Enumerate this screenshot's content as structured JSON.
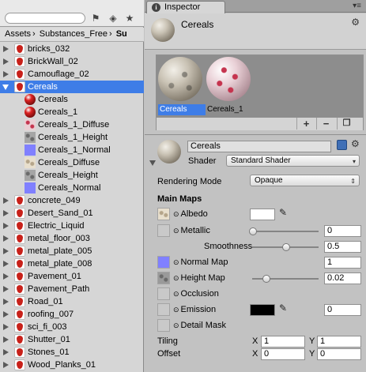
{
  "project": {
    "breadcrumb": [
      "Assets",
      "Substances_Free",
      "Su"
    ],
    "items": [
      {
        "label": "bricks_032",
        "type": "substance",
        "indent": 0,
        "expandable": true
      },
      {
        "label": "BrickWall_02",
        "type": "substance",
        "indent": 0,
        "expandable": true
      },
      {
        "label": "Camouflage_02",
        "type": "substance",
        "indent": 0,
        "expandable": true
      },
      {
        "label": "Cereals",
        "type": "substance",
        "indent": 0,
        "expandable": true,
        "expanded": true,
        "selected": true
      },
      {
        "label": "Cereals",
        "type": "material",
        "indent": 1
      },
      {
        "label": "Cereals_1",
        "type": "material",
        "indent": 1
      },
      {
        "label": "Cereals_1_Diffuse",
        "type": "texture-pink",
        "indent": 1
      },
      {
        "label": "Cereals_1_Height",
        "type": "texture-gray",
        "indent": 1
      },
      {
        "label": "Cereals_1_Normal",
        "type": "texture-blue",
        "indent": 1
      },
      {
        "label": "Cereals_Diffuse",
        "type": "texture-beige",
        "indent": 1
      },
      {
        "label": "Cereals_Height",
        "type": "texture-gray",
        "indent": 1
      },
      {
        "label": "Cereals_Normal",
        "type": "texture-blue",
        "indent": 1
      },
      {
        "label": "concrete_049",
        "type": "substance",
        "indent": 0,
        "expandable": true
      },
      {
        "label": "Desert_Sand_01",
        "type": "substance",
        "indent": 0,
        "expandable": true
      },
      {
        "label": "Electric_Liquid",
        "type": "substance",
        "indent": 0,
        "expandable": true
      },
      {
        "label": "metal_floor_003",
        "type": "substance",
        "indent": 0,
        "expandable": true
      },
      {
        "label": "metal_plate_005",
        "type": "substance",
        "indent": 0,
        "expandable": true
      },
      {
        "label": "metal_plate_008",
        "type": "substance",
        "indent": 0,
        "expandable": true
      },
      {
        "label": "Pavement_01",
        "type": "substance",
        "indent": 0,
        "expandable": true
      },
      {
        "label": "Pavement_Path",
        "type": "substance",
        "indent": 0,
        "expandable": true
      },
      {
        "label": "Road_01",
        "type": "substance",
        "indent": 0,
        "expandable": true
      },
      {
        "label": "roofing_007",
        "type": "substance",
        "indent": 0,
        "expandable": true
      },
      {
        "label": "sci_fi_003",
        "type": "substance",
        "indent": 0,
        "expandable": true
      },
      {
        "label": "Shutter_01",
        "type": "substance",
        "indent": 0,
        "expandable": true
      },
      {
        "label": "Stones_01",
        "type": "substance",
        "indent": 0,
        "expandable": true
      },
      {
        "label": "Wood_Planks_01",
        "type": "substance",
        "indent": 0,
        "expandable": true
      }
    ]
  },
  "inspector": {
    "tab_label": "Inspector",
    "header_title": "Cereals",
    "previews": [
      {
        "label": "Cereals",
        "selected": true
      },
      {
        "label": "Cereals_1",
        "selected": false
      }
    ],
    "preview_buttons": [
      "+",
      "−"
    ],
    "material": {
      "name": "Cereals",
      "shader_label": "Shader",
      "shader_value": "Standard Shader"
    },
    "rendering_mode_label": "Rendering Mode",
    "rendering_mode_value": "Opaque",
    "main_maps_label": "Main Maps",
    "albedo_label": "Albedo",
    "metallic_label": "Metallic",
    "metallic_value": "0",
    "smoothness_label": "Smoothness",
    "smoothness_value": "0.5",
    "normal_map_label": "Normal Map",
    "normal_map_value": "1",
    "height_map_label": "Height Map",
    "height_map_value": "0.02",
    "occlusion_label": "Occlusion",
    "emission_label": "Emission",
    "emission_value": "0",
    "detail_mask_label": "Detail Mask",
    "tiling_label": "Tiling",
    "tiling_x": "1",
    "tiling_y": "1",
    "offset_label": "Offset",
    "offset_x": "0",
    "offset_y": "0",
    "axis_x": "X",
    "axis_y": "Y",
    "slider_levels": {
      "metallic": 0.0,
      "smoothness": 0.5,
      "height_map": 0.2
    },
    "colors": {
      "albedo": "#ffffff",
      "emission": "#000000",
      "selection": "#3e7de7"
    }
  }
}
